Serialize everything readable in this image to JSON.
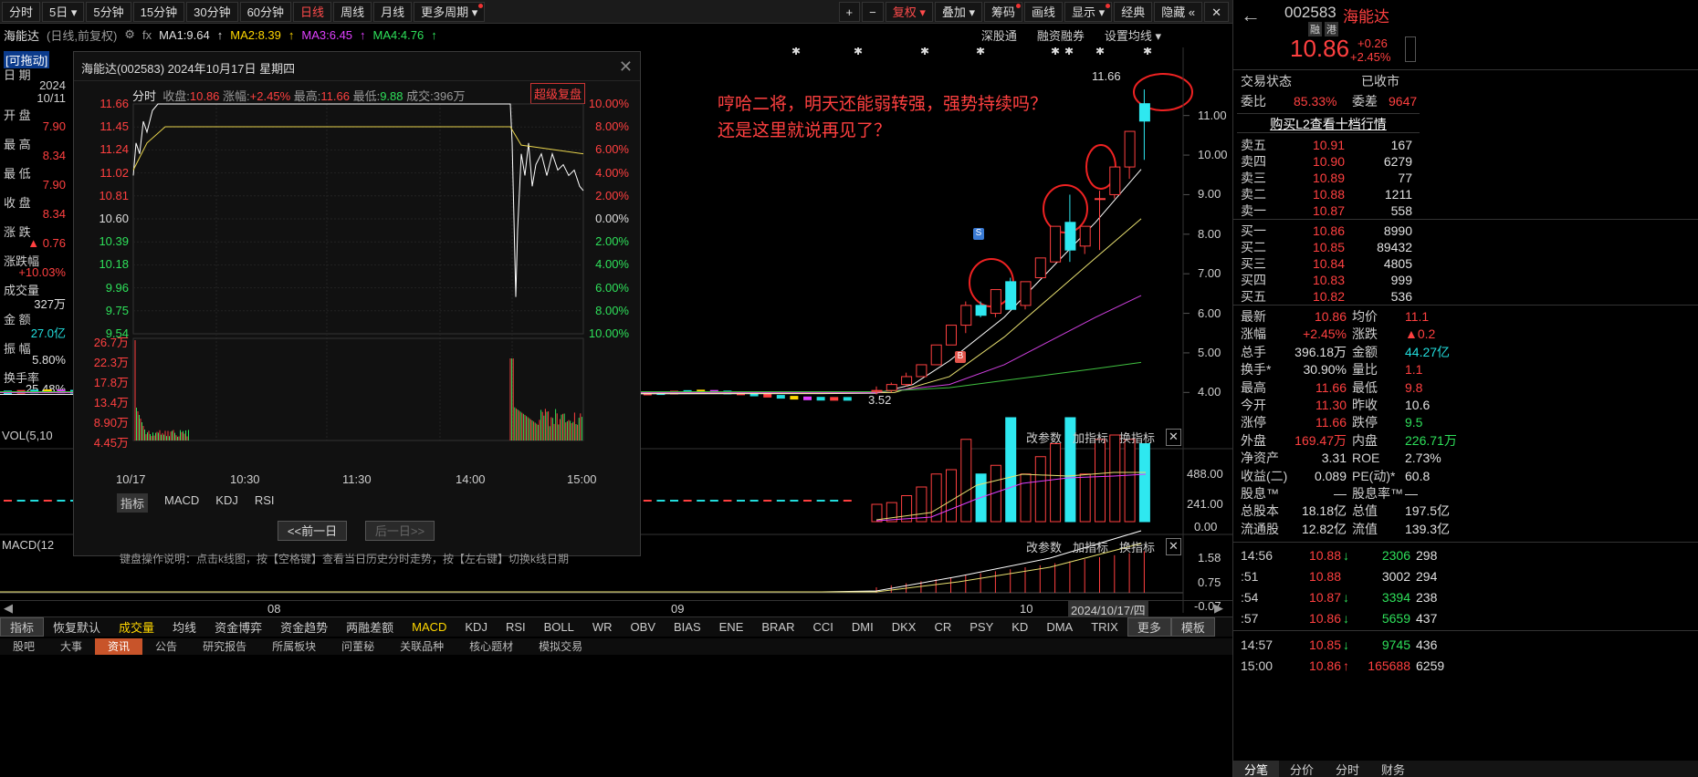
{
  "toolbar": {
    "tabs": [
      "分时",
      "5日",
      "5分钟",
      "15分钟",
      "30分钟",
      "60分钟",
      "日线",
      "周线",
      "月线",
      "更多周期"
    ],
    "right": [
      "+",
      "−",
      "复权",
      "叠加",
      "筹码",
      "画线",
      "显示",
      "经典",
      "隐藏"
    ],
    "close": "✕"
  },
  "info": {
    "name": "海能达",
    "mode": "(日线,前复权)",
    "fx": "fx",
    "ma1": "MA1:9.64",
    "ma2": "MA2:8.39",
    "ma3": "MA3:6.45",
    "ma4": "MA4:4.76",
    "links": [
      "深股通",
      "融资融券",
      "设置均线"
    ]
  },
  "left": {
    "drag": "[可拖动]",
    "date_label": "日 期",
    "year": "2024",
    "date": "10/11",
    "items": [
      {
        "k": "开 盘",
        "v": "7.90",
        "c": "red"
      },
      {
        "k": "最 高",
        "v": "8.34",
        "c": "red"
      },
      {
        "k": "最 低",
        "v": "7.90",
        "c": "red"
      },
      {
        "k": "收 盘",
        "v": "8.34",
        "c": "red"
      },
      {
        "k": "涨 跌",
        "v": "▲ 0.76",
        "c": "red"
      },
      {
        "k": "涨跌幅",
        "v": "+10.03%",
        "c": "red"
      },
      {
        "k": "成交量",
        "v": "327万",
        "c": "white"
      },
      {
        "k": "金 额",
        "v": "27.0亿",
        "c": "cyan"
      },
      {
        "k": "振 幅",
        "v": "5.80%",
        "c": "white"
      },
      {
        "k": "换手率",
        "v": "25.48%",
        "c": "white"
      }
    ]
  },
  "popup": {
    "title": "海能达(002583) 2024年10月17日 星期四",
    "fenshi": "分时",
    "shou": "收盘:",
    "shou_v": "10.86",
    "zf": "涨幅:",
    "zf_v": "+2.45%",
    "zg": "最高:",
    "zg_v": "11.66",
    "zd": "最低:",
    "zd_v": "9.88",
    "cj": "成交:396万",
    "super": "超级复盘",
    "yleft": [
      "11.66",
      "11.45",
      "11.24",
      "11.02",
      "10.81",
      "10.60",
      "10.39",
      "10.18",
      "9.96",
      "9.75",
      "9.54"
    ],
    "yright": [
      "10.00%",
      "8.00%",
      "6.00%",
      "4.00%",
      "2.00%",
      "0.00%",
      "2.00%",
      "4.00%",
      "6.00%",
      "8.00%",
      "10.00%"
    ],
    "vol": [
      "26.7万",
      "22.3万",
      "17.8万",
      "13.4万",
      "8.90万",
      "4.45万"
    ],
    "times": [
      "10/17",
      "10:30",
      "11:30",
      "14:00",
      "15:00"
    ],
    "tabs": [
      "指标",
      "MACD",
      "KDJ",
      "RSI"
    ],
    "prev": "<<前一日",
    "next": "后一日>>",
    "help": "键盘操作说明：点击k线图，按【空格键】查看当日历史分时走势，按【左右键】切换k线日期"
  },
  "annotation": {
    "line1": "哼哈二将，明天还能弱转强，强势持续吗？",
    "line2": "还是这里就说再见了？"
  },
  "chart": {
    "hi": "11.66",
    "lo": "3.52",
    "marker_s": "S",
    "marker_b": "B",
    "yaxis": [
      "11.00",
      "10.00",
      "9.00",
      "8.00",
      "7.00",
      "6.00",
      "5.00",
      "4.00"
    ],
    "vol_label": "VOL(5,10",
    "vol_axis": [
      "488.00",
      "241.00",
      "0.00"
    ],
    "macd_label": "MACD(12",
    "macd_axis": [
      "1.58",
      "0.75",
      "-0.07"
    ],
    "links": [
      "改参数",
      "加指标",
      "换指标"
    ],
    "months": [
      "08",
      "09",
      "10"
    ],
    "cursor_date": "2024/10/17/四"
  },
  "chart_data": {
    "type": "candlestick",
    "y_range": [
      3.5,
      11.8
    ],
    "candles": [
      {
        "o": 4.05,
        "h": 4.15,
        "l": 3.95,
        "c": 4.05
      },
      {
        "o": 4.05,
        "h": 4.25,
        "l": 4.0,
        "c": 4.2
      },
      {
        "o": 4.2,
        "h": 4.5,
        "l": 4.15,
        "c": 4.4
      },
      {
        "o": 4.4,
        "h": 4.7,
        "l": 4.4,
        "c": 4.7
      },
      {
        "o": 4.7,
        "h": 5.2,
        "l": 4.7,
        "c": 5.2
      },
      {
        "o": 5.2,
        "h": 5.7,
        "l": 5.2,
        "c": 5.7
      },
      {
        "o": 5.7,
        "h": 6.3,
        "l": 5.5,
        "c": 6.2
      },
      {
        "o": 6.2,
        "h": 6.3,
        "l": 5.9,
        "c": 5.95
      },
      {
        "o": 6.0,
        "h": 6.6,
        "l": 5.9,
        "c": 6.6
      },
      {
        "o": 6.8,
        "h": 6.9,
        "l": 6.1,
        "c": 6.1
      },
      {
        "o": 6.2,
        "h": 6.8,
        "l": 6.1,
        "c": 6.8
      },
      {
        "o": 6.9,
        "h": 7.4,
        "l": 6.9,
        "c": 7.4
      },
      {
        "o": 7.3,
        "h": 8.2,
        "l": 7.3,
        "c": 8.2
      },
      {
        "o": 8.3,
        "h": 9.0,
        "l": 7.3,
        "c": 7.6
      },
      {
        "o": 7.7,
        "h": 8.2,
        "l": 7.5,
        "c": 8.2
      },
      {
        "o": 8.9,
        "h": 9.1,
        "l": 7.6,
        "c": 8.9
      },
      {
        "o": 9.0,
        "h": 9.7,
        "l": 8.9,
        "c": 9.7
      },
      {
        "o": 9.7,
        "h": 10.6,
        "l": 9.4,
        "c": 10.6
      },
      {
        "o": 11.3,
        "h": 11.66,
        "l": 9.88,
        "c": 10.86
      }
    ]
  },
  "right": {
    "code": "002583",
    "name": "海能达",
    "tags": [
      "融",
      "港"
    ],
    "price": "10.86",
    "chg": "+0.26",
    "pct": "+2.45%",
    "state_k": "交易状态",
    "state_v": "已收市",
    "wb_k": "委比",
    "wb_v": "85.33%",
    "wc_k": "委差",
    "wc_v": "9647",
    "l2": "购买L2查看十档行情",
    "asks": [
      {
        "k": "卖五",
        "p": "10.91",
        "v": "167"
      },
      {
        "k": "卖四",
        "p": "10.90",
        "v": "6279"
      },
      {
        "k": "卖三",
        "p": "10.89",
        "v": "77"
      },
      {
        "k": "卖二",
        "p": "10.88",
        "v": "1211"
      },
      {
        "k": "卖一",
        "p": "10.87",
        "v": "558"
      }
    ],
    "bids": [
      {
        "k": "买一",
        "p": "10.86",
        "v": "8990"
      },
      {
        "k": "买二",
        "p": "10.85",
        "v": "89432"
      },
      {
        "k": "买三",
        "p": "10.84",
        "v": "4805"
      },
      {
        "k": "买四",
        "p": "10.83",
        "v": "999"
      },
      {
        "k": "买五",
        "p": "10.82",
        "v": "536"
      }
    ],
    "stats": [
      [
        "最新",
        "10.86",
        "red",
        "均价",
        "11.1",
        "red"
      ],
      [
        "涨幅",
        "+2.45%",
        "red",
        "涨跌",
        "▲0.2",
        "red"
      ],
      [
        "总手",
        "396.18万",
        "white",
        "金额",
        "44.27亿",
        "cyan"
      ],
      [
        "换手*",
        "30.90%",
        "white",
        "量比",
        "1.1",
        "red"
      ],
      [
        "最高",
        "11.66",
        "red",
        "最低",
        "9.8",
        "red"
      ],
      [
        "今开",
        "11.30",
        "red",
        "昨收",
        "10.6",
        "white"
      ],
      [
        "涨停",
        "11.66",
        "red",
        "跌停",
        "9.5",
        "green"
      ],
      [
        "外盘",
        "169.47万",
        "red",
        "内盘",
        "226.71万",
        "green"
      ],
      [
        "净资产",
        "3.31",
        "white",
        "ROE",
        "2.73%",
        "white"
      ],
      [
        "收益(二)",
        "0.089",
        "white",
        "PE(动)*",
        "60.8",
        "white"
      ],
      [
        "股息™",
        "—",
        "white",
        "股息率™",
        "—",
        "white"
      ],
      [
        "总股本",
        "18.18亿",
        "white",
        "总值",
        "197.5亿",
        "white"
      ],
      [
        "流通股",
        "12.82亿",
        "white",
        "流值",
        "139.3亿",
        "white"
      ]
    ],
    "ticks": [
      {
        "t": "14:56",
        "p": "10.88",
        "a": "↓",
        "v": "2306",
        "x": "298"
      },
      {
        "t": ":51",
        "p": "10.88",
        "a": "",
        "v": "3002",
        "x": "294"
      },
      {
        "t": ":54",
        "p": "10.87",
        "a": "↓",
        "v": "3394",
        "x": "238"
      },
      {
        "t": ":57",
        "p": "10.86",
        "a": "↓",
        "v": "5659",
        "x": "437"
      },
      {
        "t": "14:57",
        "p": "10.85",
        "a": "↓",
        "v": "9745",
        "x": "436"
      },
      {
        "t": "15:00",
        "p": "10.86",
        "a": "↑",
        "v": "165688",
        "x": "6259"
      }
    ],
    "bottom_tabs": [
      "分笔",
      "分价",
      "分时",
      "财务"
    ]
  },
  "bottom": {
    "indicators": [
      "指标",
      "恢复默认",
      "成交量",
      "均线",
      "资金博弈",
      "资金趋势",
      "两融差额",
      "MACD",
      "KDJ",
      "RSI",
      "BOLL",
      "WR",
      "OBV",
      "BIAS",
      "ENE",
      "BRAR",
      "CCI",
      "DMI",
      "DKX",
      "CR",
      "PSY",
      "KD",
      "DMA",
      "TRIX",
      "更多",
      "模板"
    ],
    "tabs": [
      "股吧",
      "大事",
      "资讯",
      "公告",
      "研究报告",
      "所属板块",
      "问董秘",
      "关联品种",
      "核心题材",
      "模拟交易"
    ]
  }
}
